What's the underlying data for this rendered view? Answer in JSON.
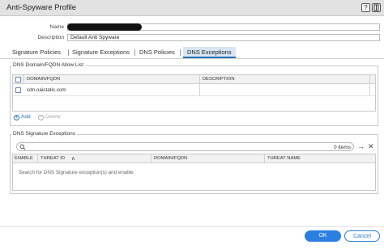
{
  "window": {
    "title": "Anti-Spyware Profile",
    "help_icon": "help-icon",
    "maximize_icon": "maximize-icon"
  },
  "form": {
    "name_label": "Name",
    "name_value": "",
    "description_label": "Description",
    "description_value": "Default Anti Spyware"
  },
  "tabs": [
    {
      "label": "Signature Policies",
      "active": false
    },
    {
      "label": "Signature Exceptions",
      "active": false
    },
    {
      "label": "DNS Policies",
      "active": false
    },
    {
      "label": "DNS Exceptions",
      "active": true
    }
  ],
  "allow_list": {
    "legend": "DNS Domain/FQDN Allow List",
    "columns": [
      "DOMAIN/FQDN",
      "DESCRIPTION"
    ],
    "rows": [
      {
        "domain": "cdn.oaistatic.com",
        "description": ""
      }
    ],
    "add_label": "Add",
    "delete_label": "Delete"
  },
  "signature_exceptions": {
    "legend": "DNS Signature Exceptions",
    "search_placeholder": "",
    "item_count": "0 items",
    "columns": [
      "ENABLE",
      "THREAT ID",
      "DOMAIN/FQDN",
      "THREAT NAME"
    ],
    "empty_message": "Search for DNS Signature exception(s) and enable"
  },
  "footer": {
    "ok_label": "OK",
    "cancel_label": "Cancel"
  },
  "colors": {
    "accent": "#2b7fe0",
    "tab_active_bg": "#d8e6f3"
  }
}
